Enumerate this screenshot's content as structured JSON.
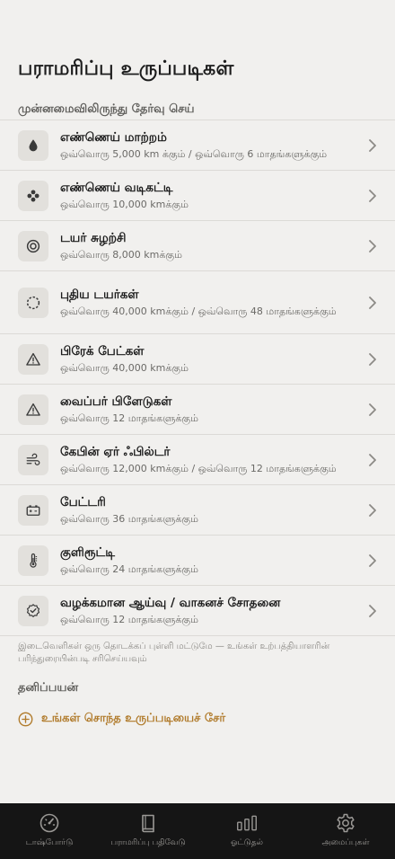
{
  "header": {
    "title": "பராமரிப்பு உருப்படிகள்",
    "section_label": "முன்னமைவிலிருந்து தேர்வு செய்"
  },
  "presets": [
    {
      "name": "எண்ணெய் மாற்றம்",
      "desc": "ஒவ்வொரு 5,000 km க்கும் / ஒவ்வொரு 6 மாதங்களுக்கும்",
      "icon": "drop-icon"
    },
    {
      "name": "எண்ணெய் வடிகட்டி",
      "desc": "ஒவ்வொரு 10,000 kmக்கும்",
      "icon": "filter-dots-icon"
    },
    {
      "name": "டயர் சுழற்சி",
      "desc": "ஒவ்வொரு 8,000 kmக்கும்",
      "icon": "target-icon"
    },
    {
      "name": "புதிய டயர்கள்",
      "desc": "ஒவ்வொரு 40,000 kmக்கும் / ஒவ்வொரு 48 மாதங்களுக்கும்",
      "icon": "dashed-circle-icon"
    },
    {
      "name": "பிரேக் பேட்கள்",
      "desc": "ஒவ்வொரு 40,000 kmக்கும்",
      "icon": "warning-icon"
    },
    {
      "name": "வைப்பர் பிளேடுகள்",
      "desc": "ஒவ்வொரு 12 மாதங்களுக்கும்",
      "icon": "warning-icon"
    },
    {
      "name": "கேபின் ஏர் ஃபில்டர்",
      "desc": "ஒவ்வொரு 12,000 kmக்கும் / ஒவ்வொரு 12 மாதங்களுக்கும்",
      "icon": "wind-icon"
    },
    {
      "name": "பேட்டரி",
      "desc": "ஒவ்வொரு 36 மாதங்களுக்கும்",
      "icon": "battery-icon"
    },
    {
      "name": "குளிரூட்டி",
      "desc": "ஒவ்வொரு 24 மாதங்களுக்கும்",
      "icon": "thermometer-icon"
    },
    {
      "name": "வழக்கமான ஆய்வு / வாகனச் சோதனை",
      "desc": "ஒவ்வொரு 12 மாதங்களுக்கும்",
      "icon": "check-badge-icon"
    }
  ],
  "note": "இடைவெளிகள் ஒரு தொடக்கப் புள்ளி மட்டுமே — உங்கள் உற்பத்தியாளரின் பரிந்துரையின்படி சரிசெய்யவும்",
  "custom": {
    "label": "தனிப்பயன்",
    "add_label": "உங்கள் சொந்த உருப்படியைச் சேர்"
  },
  "tabs": [
    {
      "label": "டாஷ்போர்டு",
      "icon": "speedometer-icon"
    },
    {
      "label": "பராமரிப்பு பதிவேடு",
      "icon": "book-icon"
    },
    {
      "label": "ஓட்டுதல்",
      "icon": "bar-chart-icon"
    },
    {
      "label": "அமைப்புகள்",
      "icon": "gear-icon"
    }
  ],
  "colors": {
    "background": "#f1f0ee",
    "accent": "#b07a2a",
    "tabbar": "#151515"
  }
}
